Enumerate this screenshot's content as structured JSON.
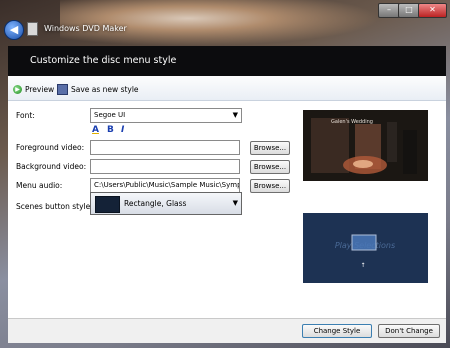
{
  "window": {
    "title": "Windows DVD Maker",
    "controls": {
      "minimize": "–",
      "maximize": "□",
      "close": "✕"
    },
    "back_glyph": "◀"
  },
  "header": {
    "title": "Customize the disc menu style"
  },
  "toolbar": {
    "preview_label": "Preview",
    "save_label": "Save as new style"
  },
  "form": {
    "font_label": "Font:",
    "font_value": "Segoe UI",
    "format_buttons": {
      "color": "A",
      "bold": "B",
      "italic": "I"
    },
    "foreground_label": "Foreground video:",
    "foreground_value": "",
    "background_label": "Background video:",
    "background_value": "",
    "audio_label": "Menu audio:",
    "audio_value": "C:\\Users\\Public\\Music\\Sample Music\\Sympho",
    "scenes_label": "Scenes button styles:",
    "scenes_value": "Rectangle, Glass",
    "browse_label": "Browse..."
  },
  "preview": {
    "caption": "Galen's Wedding",
    "menu_text": "Play Selections"
  },
  "buttons": {
    "change_label": "Change Style",
    "dont_change_label": "Don't Change"
  },
  "colors": {
    "header_bg": "#0c0c0e",
    "menu_bg": "#1d3253",
    "accent": "#5a6fa8"
  }
}
